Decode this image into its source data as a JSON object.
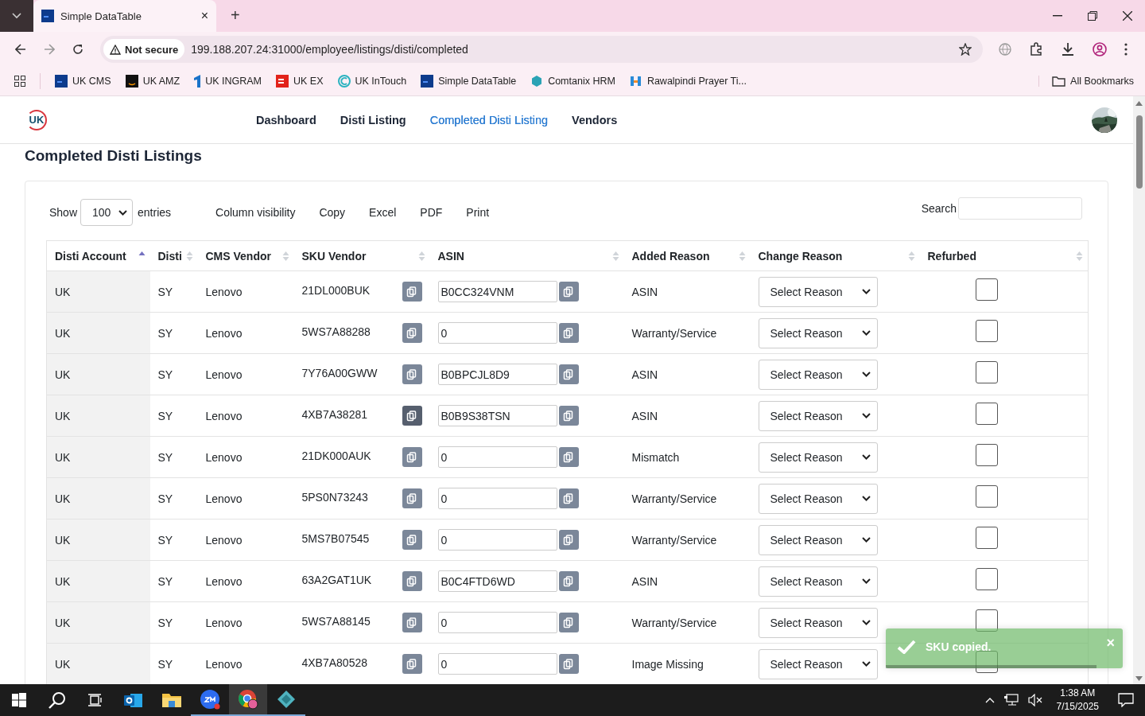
{
  "browser": {
    "tab": {
      "title": "Simple DataTable",
      "close": "×"
    },
    "new_tab": "+",
    "security": "Not secure",
    "url": "199.188.207.24:31000/employee/listings/disti/completed",
    "bookmarks": [
      {
        "label": "UK CMS"
      },
      {
        "label": "UK AMZ"
      },
      {
        "label": "UK INGRAM"
      },
      {
        "label": "UK EX"
      },
      {
        "label": "UK InTouch"
      },
      {
        "label": "Simple DataTable"
      },
      {
        "label": "Comtanix HRM"
      },
      {
        "label": "Rawalpindi Prayer Ti..."
      }
    ],
    "all_bookmarks": "All Bookmarks"
  },
  "header": {
    "logo_text": "UK",
    "nav": [
      {
        "label": "Dashboard",
        "selected": false
      },
      {
        "label": "Disti Listing",
        "selected": false
      },
      {
        "label": "Completed Disti Listing",
        "selected": true
      },
      {
        "label": "Vendors",
        "selected": false
      }
    ]
  },
  "page_title": "Completed Disti Listings",
  "table_controls": {
    "show_label": "Show",
    "page_length": "100",
    "entries_label": "entries",
    "buttons": [
      "Column visibility",
      "Copy",
      "Excel",
      "PDF",
      "Print"
    ],
    "search_label": "Search"
  },
  "table": {
    "columns": [
      {
        "label": "Disti Account",
        "sorted": true
      },
      {
        "label": "Disti",
        "sorted": false
      },
      {
        "label": "CMS Vendor",
        "sorted": false
      },
      {
        "label": "SKU Vendor",
        "sorted": false
      },
      {
        "label": "ASIN",
        "sorted": false
      },
      {
        "label": "Added Reason",
        "sorted": false
      },
      {
        "label": "Change Reason",
        "sorted": false
      },
      {
        "label": "Refurbed",
        "sorted": false
      }
    ],
    "rows": [
      {
        "disti_account": "UK",
        "disti": "SY",
        "cms_vendor": "Lenovo",
        "sku_vendor": "21DL000BUK",
        "sku_copy_pressed": false,
        "asin": "B0CC324VNM",
        "added_reason": "ASIN",
        "change_reason": "Select Reason",
        "refurbed": false
      },
      {
        "disti_account": "UK",
        "disti": "SY",
        "cms_vendor": "Lenovo",
        "sku_vendor": "5WS7A88288",
        "sku_copy_pressed": false,
        "asin": "0",
        "added_reason": "Warranty/Service",
        "change_reason": "Select Reason",
        "refurbed": false
      },
      {
        "disti_account": "UK",
        "disti": "SY",
        "cms_vendor": "Lenovo",
        "sku_vendor": "7Y76A00GWW",
        "sku_copy_pressed": false,
        "asin": "B0BPCJL8D9",
        "added_reason": "ASIN",
        "change_reason": "Select Reason",
        "refurbed": false
      },
      {
        "disti_account": "UK",
        "disti": "SY",
        "cms_vendor": "Lenovo",
        "sku_vendor": "4XB7A38281",
        "sku_copy_pressed": true,
        "asin": "B0B9S38TSN",
        "added_reason": "ASIN",
        "change_reason": "Select Reason",
        "refurbed": false
      },
      {
        "disti_account": "UK",
        "disti": "SY",
        "cms_vendor": "Lenovo",
        "sku_vendor": "21DK000AUK",
        "sku_copy_pressed": false,
        "asin": "0",
        "added_reason": "Mismatch",
        "change_reason": "Select Reason",
        "refurbed": false
      },
      {
        "disti_account": "UK",
        "disti": "SY",
        "cms_vendor": "Lenovo",
        "sku_vendor": "5PS0N73243",
        "sku_copy_pressed": false,
        "asin": "0",
        "added_reason": "Warranty/Service",
        "change_reason": "Select Reason",
        "refurbed": false
      },
      {
        "disti_account": "UK",
        "disti": "SY",
        "cms_vendor": "Lenovo",
        "sku_vendor": "5MS7B07545",
        "sku_copy_pressed": false,
        "asin": "0",
        "added_reason": "Warranty/Service",
        "change_reason": "Select Reason",
        "refurbed": false
      },
      {
        "disti_account": "UK",
        "disti": "SY",
        "cms_vendor": "Lenovo",
        "sku_vendor": "63A2GAT1UK",
        "sku_copy_pressed": false,
        "asin": "B0C4FTD6WD",
        "added_reason": "ASIN",
        "change_reason": "Select Reason",
        "refurbed": false
      },
      {
        "disti_account": "UK",
        "disti": "SY",
        "cms_vendor": "Lenovo",
        "sku_vendor": "5WS7A88145",
        "sku_copy_pressed": false,
        "asin": "0",
        "added_reason": "Warranty/Service",
        "change_reason": "Select Reason",
        "refurbed": false
      },
      {
        "disti_account": "UK",
        "disti": "SY",
        "cms_vendor": "Lenovo",
        "sku_vendor": "4XB7A80528",
        "sku_copy_pressed": false,
        "asin": "0",
        "added_reason": "Image Missing",
        "change_reason": "Select Reason",
        "refurbed": false
      }
    ]
  },
  "toast": {
    "message": "SKU copied.",
    "close": "×",
    "level": 0.89
  },
  "taskbar": {
    "time": "1:38 AM",
    "date": "7/15/2025"
  }
}
